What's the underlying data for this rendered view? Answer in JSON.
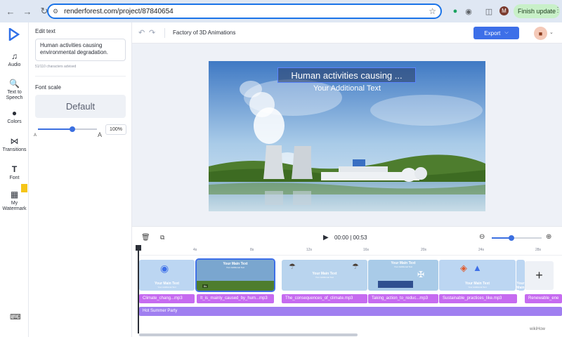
{
  "browser": {
    "url": "renderforest.com/project/87840654",
    "finish_update": "Finish update",
    "profile_initial": "M"
  },
  "rail": {
    "items": [
      {
        "label": "Audio",
        "icon": "music-note-icon"
      },
      {
        "label": "Text to Speech",
        "icon": "text-to-speech-icon"
      },
      {
        "label": "Colors",
        "icon": "palette-icon"
      },
      {
        "label": "Transitions",
        "icon": "transitions-icon"
      },
      {
        "label": "Font",
        "icon": "font-icon"
      },
      {
        "label": "My Watermark",
        "icon": "watermark-icon"
      }
    ]
  },
  "panel": {
    "title": "Edit text",
    "text_value": "Human activities causing environmental degradation.",
    "chars": "51/110 characters advised",
    "font_scale_title": "Font scale",
    "font_scale_value": "Default",
    "scale_small": "A",
    "scale_large": "A",
    "scale_percent": "100%",
    "scale_level": 0.58
  },
  "topbar": {
    "project_name": "Factory of 3D Animations",
    "export_label": "Export"
  },
  "preview": {
    "headline": "Human activities causing ...",
    "subline": "Your Additional Text"
  },
  "timeline": {
    "timecode": "00:00 | 00:53",
    "zoom_level": 0.4,
    "ticks": [
      "4s",
      "8s",
      "12s",
      "16s",
      "20s",
      "24s",
      "28s"
    ],
    "scenes": [
      {
        "title": "Your Main Text",
        "sub": "Your Additional Text"
      },
      {
        "title": "Your Main Text",
        "sub": "Your Additional Text",
        "badge": "6s"
      },
      {
        "title": "Your Main Text",
        "sub": "Your Additional Text"
      },
      {
        "title": "Your Main Text",
        "sub": "Your Additional Text"
      },
      {
        "title": "Your Main Text",
        "sub": "Your Additional Text"
      },
      {
        "title": "Your Main Text",
        "sub": "Your Additional Text"
      }
    ],
    "audio_clips": [
      "Climate_chang...mp3",
      "It_is_mainly_caused_by_hum...mp3",
      "The_consequences_of_climate.mp3",
      "Taking_action_to_reduc...mp3",
      "Sustainable_practices_like.mp3",
      "Renewable_ene"
    ],
    "music_track": "Hot Summer Party"
  },
  "footer": {
    "watermark": "wikiHow"
  },
  "colors": {
    "accent": "#3d6fe8",
    "audio_clip": "#c66bf0",
    "music_track": "#a07ff0"
  }
}
